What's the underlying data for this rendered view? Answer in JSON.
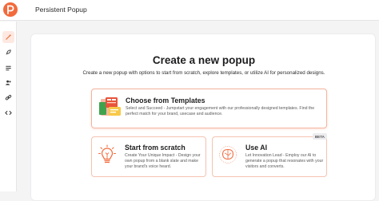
{
  "app": {
    "title": "Persistent Popup"
  },
  "colors": {
    "brand": "#f26a3c",
    "card_border": "#f5c3b0"
  },
  "sidebar": {
    "items": [
      {
        "icon": "magic-wand-icon",
        "active": true
      },
      {
        "icon": "rocket-icon",
        "active": false
      },
      {
        "icon": "list-icon",
        "active": false
      },
      {
        "icon": "users-icon",
        "active": false
      },
      {
        "icon": "link-icon",
        "active": false
      },
      {
        "icon": "code-icon",
        "active": false
      }
    ]
  },
  "main": {
    "heading": "Create a new popup",
    "subheading": "Create a new popup with options to start from scratch, explore templates, or utilize AI for personalized designs.",
    "cards": {
      "templates": {
        "title": "Choose from Templates",
        "description": "Select and Succeed - Jumpstart your engagement with our professionally designed templates. Find the perfect match for your brand, usecase and audience.",
        "icon": "templates-icon"
      },
      "scratch": {
        "title": "Start from scratch",
        "description": "Create Your Unique Impact - Design your own popup from a blank slate and make your brand's voice heard.",
        "icon": "lightbulb-icon"
      },
      "ai": {
        "title": "Use AI",
        "description": "Let Innovation Lead - Employ our AI to generate a popup that resonates with your visitors and converts.",
        "badge": "BETA",
        "icon": "ai-brain-icon"
      }
    }
  }
}
